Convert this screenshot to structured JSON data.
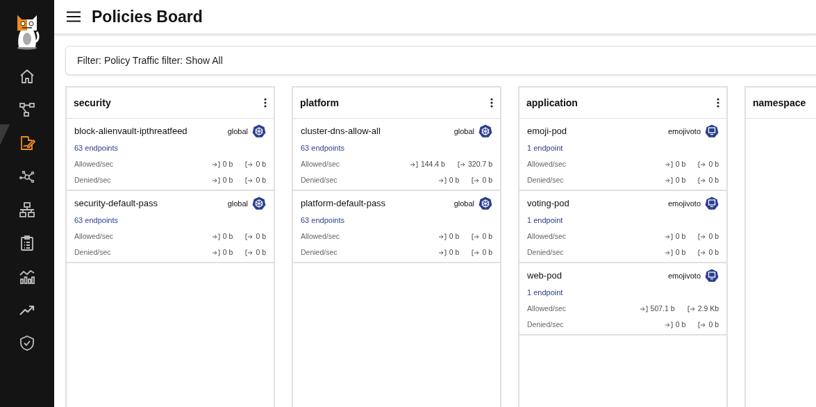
{
  "sidebar": {
    "items": [
      {
        "selected": false
      },
      {
        "selected": false
      },
      {
        "selected": true
      },
      {
        "selected": false
      },
      {
        "selected": false
      },
      {
        "selected": false
      },
      {
        "selected": false
      },
      {
        "selected": false
      },
      {
        "selected": false
      }
    ]
  },
  "header": {
    "title": "Policies Board"
  },
  "filter": {
    "text": "Filter: Policy Traffic filter: Show All"
  },
  "tiers": [
    {
      "name": "security",
      "policies": [
        {
          "name": "block-alienvault-ipthreatfeed",
          "scope": "global",
          "kind": "global",
          "endpoints": "63 endpoints",
          "stats": [
            {
              "label": "Allowed/sec",
              "in": "0 b",
              "out": "0 b"
            },
            {
              "label": "Denied/sec",
              "in": "0 b",
              "out": "0 b"
            }
          ]
        },
        {
          "name": "security-default-pass",
          "scope": "global",
          "kind": "global",
          "endpoints": "63 endpoints",
          "stats": [
            {
              "label": "Allowed/sec",
              "in": "0 b",
              "out": "0 b"
            },
            {
              "label": "Denied/sec",
              "in": "0 b",
              "out": "0 b"
            }
          ]
        }
      ]
    },
    {
      "name": "platform",
      "policies": [
        {
          "name": "cluster-dns-allow-all",
          "scope": "global",
          "kind": "global",
          "endpoints": "63 endpoints",
          "stats": [
            {
              "label": "Allowed/sec",
              "in": "144.4 b",
              "out": "320.7 b"
            },
            {
              "label": "Denied/sec",
              "in": "0 b",
              "out": "0 b"
            }
          ]
        },
        {
          "name": "platform-default-pass",
          "scope": "global",
          "kind": "global",
          "endpoints": "63 endpoints",
          "stats": [
            {
              "label": "Allowed/sec",
              "in": "0 b",
              "out": "0 b"
            },
            {
              "label": "Denied/sec",
              "in": "0 b",
              "out": "0 b"
            }
          ]
        }
      ]
    },
    {
      "name": "application",
      "policies": [
        {
          "name": "emoji-pod",
          "scope": "emojivoto",
          "kind": "namespace",
          "endpoints": "1 endpoint",
          "stats": [
            {
              "label": "Allowed/sec",
              "in": "0 b",
              "out": "0 b"
            },
            {
              "label": "Denied/sec",
              "in": "0 b",
              "out": "0 b"
            }
          ]
        },
        {
          "name": "voting-pod",
          "scope": "emojivoto",
          "kind": "namespace",
          "endpoints": "1 endpoint",
          "stats": [
            {
              "label": "Allowed/sec",
              "in": "0 b",
              "out": "0 b"
            },
            {
              "label": "Denied/sec",
              "in": "0 b",
              "out": "0 b"
            }
          ]
        },
        {
          "name": "web-pod",
          "scope": "emojivoto",
          "kind": "namespace",
          "endpoints": "1 endpoint",
          "stats": [
            {
              "label": "Allowed/sec",
              "in": "507.1 b",
              "out": "2.9 Kb"
            },
            {
              "label": "Denied/sec",
              "in": "0 b",
              "out": "0 b"
            }
          ]
        }
      ]
    },
    {
      "name": "namespace"
    }
  ]
}
